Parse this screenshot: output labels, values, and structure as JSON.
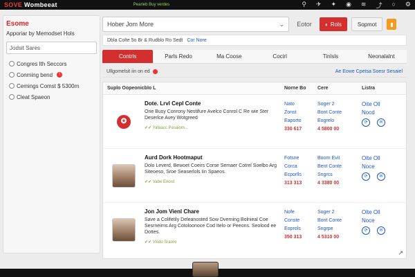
{
  "topbar": {
    "brand": "SOVE",
    "app_name": "Wombeeat",
    "status": "Pearleb Buy verdes",
    "icons": [
      "pin-icon",
      "send-icon",
      "star-icon",
      "globe-icon",
      "wifi-icon",
      "share-icon",
      "ring-icon",
      "gear-icon"
    ]
  },
  "sidebar": {
    "title": "Esome",
    "subtitle": "Apporiar by Memodset Hols",
    "input_value": "Jodsit Sares",
    "options": [
      {
        "label": "Congres Ith Seccors",
        "badge": false
      },
      {
        "label": "Conming bend",
        "badge": true
      },
      {
        "label": "Cemings Comst $ 5300m",
        "badge": false
      },
      {
        "label": "Cleat Spaeon",
        "badge": false
      }
    ]
  },
  "search": {
    "value": "Hober Jom More",
    "filter_label": "Eotor",
    "primary_label": "Rols",
    "secondary_label": "Sopmot",
    "subrow_text": "Dbla Colte 5o Br & Rudblo Ro Sedt",
    "subrow_link": "Cor Nore"
  },
  "tabs": [
    "Contrls",
    "Parls Redo",
    "Ma Coose",
    "Cocirl",
    "Tinlsls",
    "Neonalalnt"
  ],
  "filterbar": {
    "left": "Ullgomelsit iin on ed",
    "right": "Ae Eowe Cpetsa Soesr Sesaiel"
  },
  "table": {
    "headers": {
      "main": "Suplo Oopeonicblo L",
      "c1": "Norne Bo",
      "c2": "Cere",
      "c3": "Listra"
    },
    "rows": [
      {
        "thumb": "logo",
        "title": "Dote. Lrvl Cepl Conte",
        "desc": "One Busy Conrony Nestifure Avelco Conrol C Re wie Ster Deserlce Avey Wotgreed",
        "meta": "Yafaacc Pasaiom...",
        "c1": [
          "Nato",
          "Zonst",
          "Eaporto"
        ],
        "c1_price": "330 617",
        "c2": [
          "Soger 2",
          "Bont Conte",
          "Eogrelo"
        ],
        "c2_price": "4 5800 00",
        "c3": [
          "Oite Oll",
          "Nocd"
        ]
      },
      {
        "thumb": "photo",
        "title": "Aurd Dork Hootmaput",
        "desc": "Dolo Leverd, Bewoet Coeirs Corse Semaer Cotrel Soelbo Arg Siteoeso, Sroe Seaserlols Iin Spaeos.",
        "meta": "Vabe Eriord",
        "c1": [
          "Fotsne",
          "Corca",
          "Ecporlls"
        ],
        "c1_price": "313 313",
        "c2": [
          "Boorn Evit",
          "Bent Conte",
          "Sngrcs"
        ],
        "c2_price": "4 3380 00",
        "c3": [
          "Olte Oll",
          "Noce"
        ]
      },
      {
        "thumb": "photo",
        "title": "Jon Jom Vienl Chare",
        "desc": "Save a Colifetily Deleanosted Sow Dverning Bolnieal Coe Sesrneirns Arg Cotoloonoce Cod Itelo or Peeons. Seolood ee Dottes.",
        "meta": "Visdo Sraore",
        "c1": [
          "Nofe",
          "Conste",
          "Eoprols"
        ],
        "c1_price": "350 313",
        "c2": [
          "Soger 2",
          "Bont Conte",
          "Sngrpe"
        ],
        "c2_price": "4 5310 00",
        "c3": [
          "Olte Oll",
          "Noce"
        ]
      }
    ]
  },
  "colors": {
    "accent": "#d32f2f",
    "link": "#1a56c7",
    "orange": "#f59b1b"
  }
}
